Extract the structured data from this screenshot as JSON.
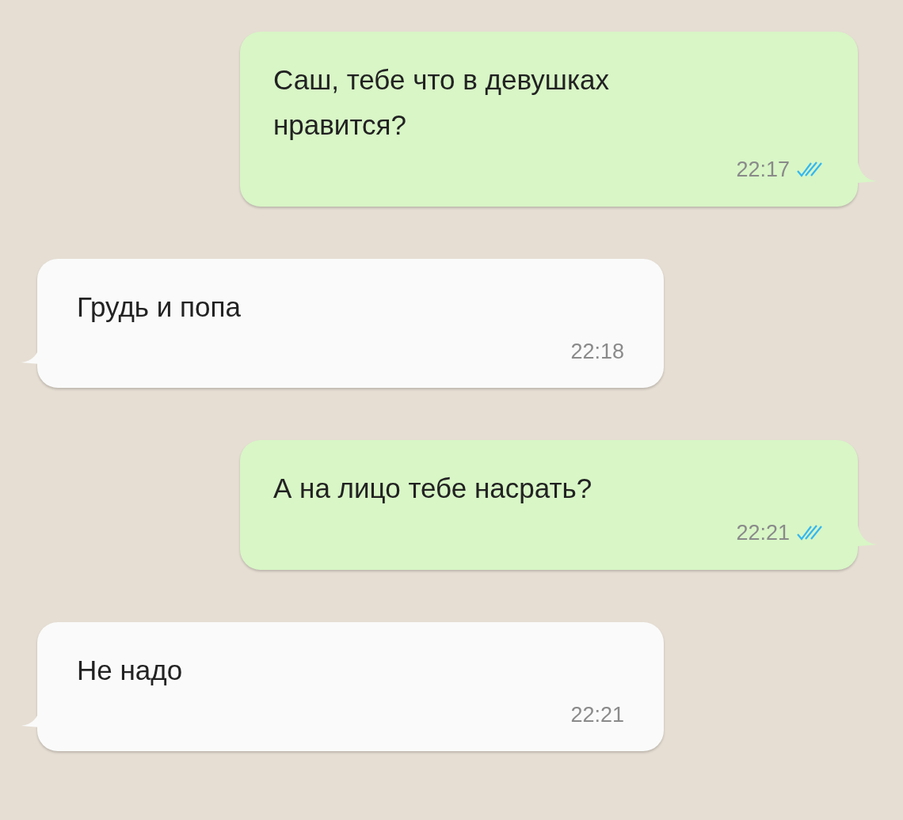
{
  "messages": [
    {
      "kind": "outgoing",
      "text": "Саш, тебе что в девушках нравится?",
      "time": "22:17",
      "read": true
    },
    {
      "kind": "incoming",
      "text": "Грудь и попа",
      "time": "22:18"
    },
    {
      "kind": "outgoing",
      "text": "А на лицо тебе насрать?",
      "time": "22:21",
      "read": true
    },
    {
      "kind": "incoming",
      "text": "Не надо",
      "time": "22:21"
    }
  ]
}
